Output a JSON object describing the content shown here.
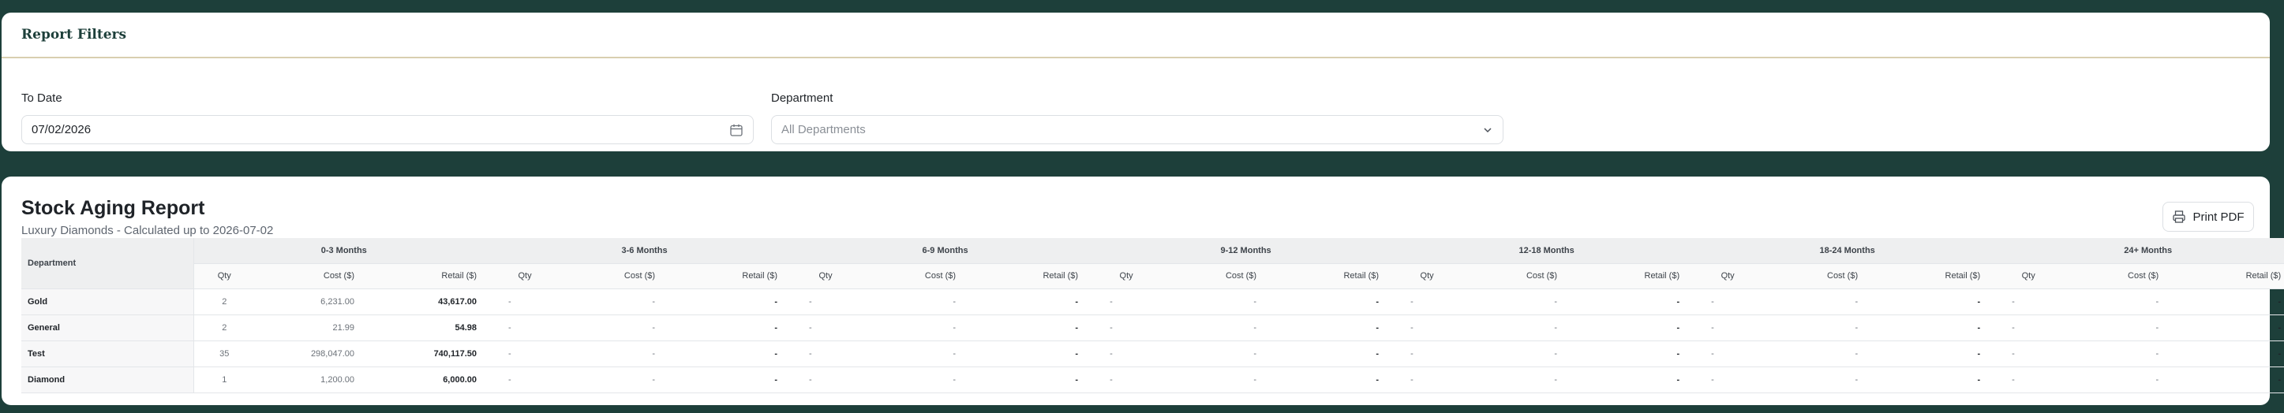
{
  "filters": {
    "title": "Report Filters",
    "to_date_label": "To Date",
    "to_date_value": "07/02/2026",
    "department_label": "Department",
    "department_value": "All Departments"
  },
  "report": {
    "title": "Stock Aging Report",
    "subtitle": "Luxury Diamonds - Calculated up to 2026-07-02",
    "print_label": "Print PDF",
    "dept_header": "Department",
    "buckets": [
      "0-3 Months",
      "3-6 Months",
      "6-9 Months",
      "9-12 Months",
      "12-18 Months",
      "18-24 Months",
      "24+ Months"
    ],
    "sub_headers": {
      "qty": "Qty",
      "cost": "Cost ($)",
      "retail": "Retail ($)"
    },
    "rows": [
      {
        "department": "Gold",
        "qty": "2",
        "cost": "6,231.00",
        "retail": "43,617.00"
      },
      {
        "department": "General",
        "qty": "2",
        "cost": "21.99",
        "retail": "54.98"
      },
      {
        "department": "Test",
        "qty": "35",
        "cost": "298,047.00",
        "retail": "740,117.50"
      },
      {
        "department": "Diamond",
        "qty": "1",
        "cost": "1,200.00",
        "retail": "6,000.00"
      }
    ],
    "empty_value": "-"
  },
  "icons": {
    "calendar": "calendar-icon",
    "chevron": "chevron-down-icon",
    "printer": "printer-icon"
  },
  "colors": {
    "background": "#1d3f3a",
    "accent_line": "#d9cfb0",
    "card": "#ffffff"
  }
}
